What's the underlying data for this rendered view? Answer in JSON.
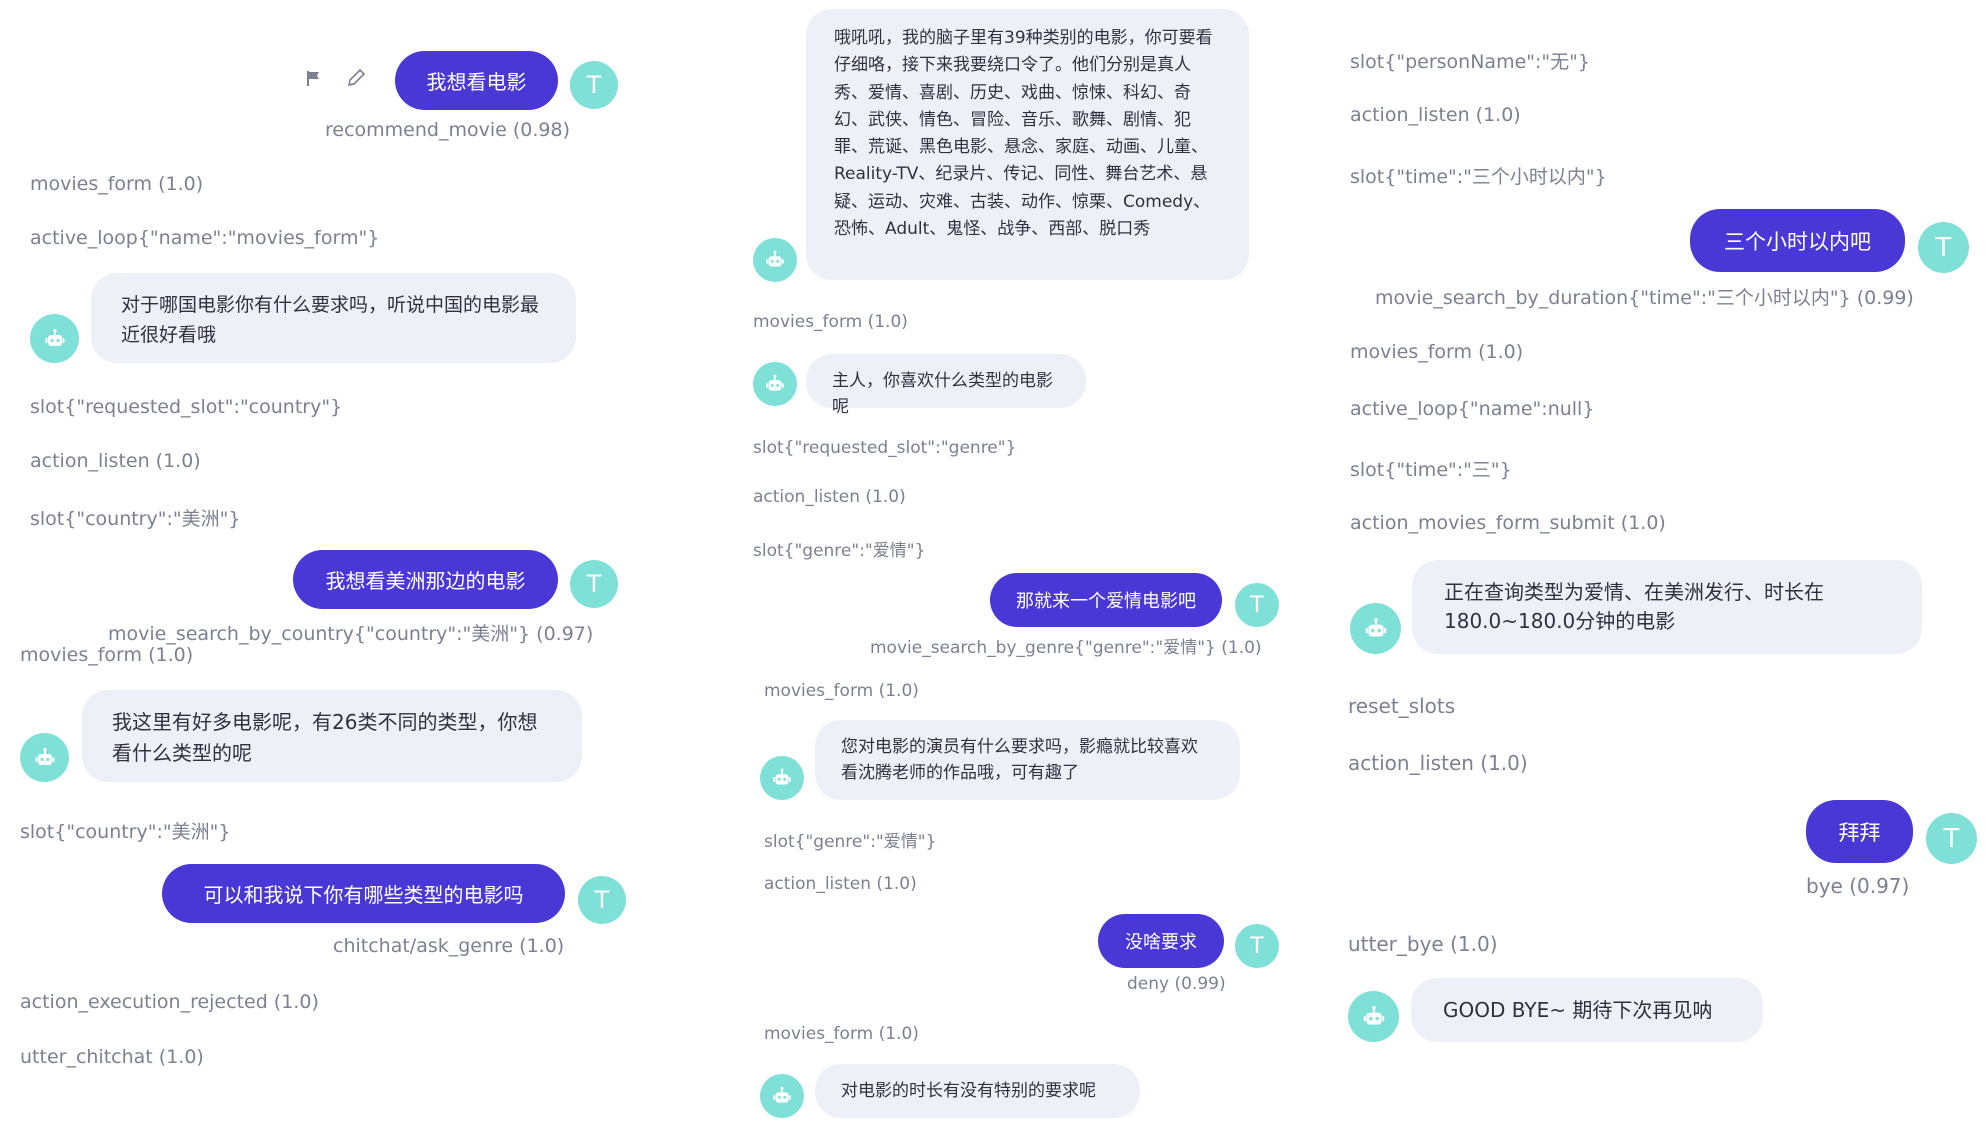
{
  "avatar": {
    "user_initial": "T"
  },
  "col1": {
    "u1": {
      "text": "我想看电影",
      "intent": "recommend_movie (0.98)"
    },
    "e1": "movies_form (1.0)",
    "e2": "active_loop{\"name\":\"movies_form\"}",
    "b1": "对于哪国电影你有什么要求吗，听说中国的电影最近很好看哦",
    "e3": "slot{\"requested_slot\":\"country\"}",
    "e4": "action_listen (1.0)",
    "e5": "slot{\"country\":\"美洲\"}",
    "u2": {
      "text": "我想看美洲那边的电影",
      "intent": "movie_search_by_country{\"country\":\"美洲\"} (0.97)"
    },
    "e6": "movies_form (1.0)",
    "b2": "我这里有好多电影呢，有26类不同的类型，你想看什么类型的呢",
    "e7": "slot{\"country\":\"美洲\"}",
    "u3": {
      "text": "可以和我说下你有哪些类型的电影吗",
      "intent": "chitchat/ask_genre (1.0)"
    },
    "e8": "action_execution_rejected (1.0)",
    "e9": "utter_chitchat (1.0)"
  },
  "col2": {
    "b1": "哦吼吼，我的脑子里有39种类别的电影，你可要看仔细咯，接下来我要绕口令了。他们分别是真人秀、爱情、喜剧、历史、戏曲、惊悚、科幻、奇幻、武侠、情色、冒险、音乐、歌舞、剧情、犯罪、荒诞、黑色电影、悬念、家庭、动画、儿童、Reality-TV、纪录片、传记、同性、舞台艺术、悬疑、运动、灾难、古装、动作、惊栗、Comedy、恐怖、Adult、鬼怪、战争、西部、脱口秀",
    "e1": "movies_form (1.0)",
    "b2": "主人，你喜欢什么类型的电影呢",
    "e2": "slot{\"requested_slot\":\"genre\"}",
    "e3": "action_listen (1.0)",
    "e4": "slot{\"genre\":\"爱情\"}",
    "u1": {
      "text": "那就来一个爱情电影吧",
      "intent": "movie_search_by_genre{\"genre\":\"爱情\"} (1.0)"
    },
    "e5": "movies_form (1.0)",
    "b3": "您对电影的演员有什么要求吗，影瘾就比较喜欢看沈腾老师的作品哦，可有趣了",
    "e6": "slot{\"genre\":\"爱情\"}",
    "e7": "action_listen (1.0)",
    "u2": {
      "text": "没啥要求",
      "intent": "deny (0.99)"
    },
    "e8": "movies_form (1.0)",
    "b4": "对电影的时长有没有特别的要求呢"
  },
  "col3": {
    "e1": "slot{\"personName\":\"无\"}",
    "e2": "action_listen (1.0)",
    "e3": "slot{\"time\":\"三个小时以内\"}",
    "u1": {
      "text": "三个小时以内吧",
      "intent": "movie_search_by_duration{\"time\":\"三个小时以内\"} (0.99)"
    },
    "e4": "movies_form (1.0)",
    "e5": "active_loop{\"name\":null}",
    "e6": "slot{\"time\":\"三\"}",
    "e7": "action_movies_form_submit (1.0)",
    "b1": "正在查询类型为爱情、在美洲发行、时长在180.0~180.0分钟的电影",
    "e8": "reset_slots",
    "e9": "action_listen (1.0)",
    "u2": {
      "text": "拜拜",
      "intent": "bye (0.97)"
    },
    "e10": "utter_bye (1.0)",
    "b2": "GOOD BYE~ 期待下次再见呐"
  }
}
